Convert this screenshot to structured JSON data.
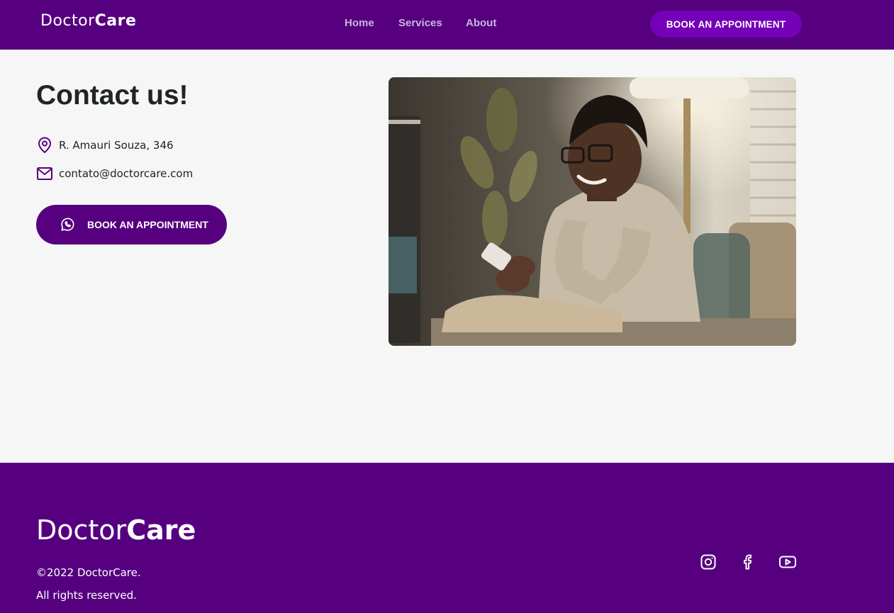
{
  "header": {
    "logo_regular": "Doctor",
    "logo_bold": "Care",
    "nav": [
      "Home",
      "Services",
      "About"
    ],
    "cta_label": "BOOK AN APPOINTMENT"
  },
  "contact": {
    "title": "Contact us!",
    "address": "R. Amauri Souza, 346",
    "email": "contato@doctorcare.com",
    "cta_label": "BOOK AN APPOINTMENT"
  },
  "photo": {
    "alt": "Man smiling while using a smartphone"
  },
  "footer": {
    "logo_regular": "Doctor",
    "logo_bold": "Care",
    "copyright": "©2022 DoctorCare.",
    "rights": "All rights reserved.",
    "social": [
      "instagram-icon",
      "facebook-icon",
      "youtube-icon"
    ]
  },
  "colors": {
    "primary": "#560080",
    "accent": "#7400B8",
    "background": "#F5F6F5",
    "text": "#1F2428"
  }
}
